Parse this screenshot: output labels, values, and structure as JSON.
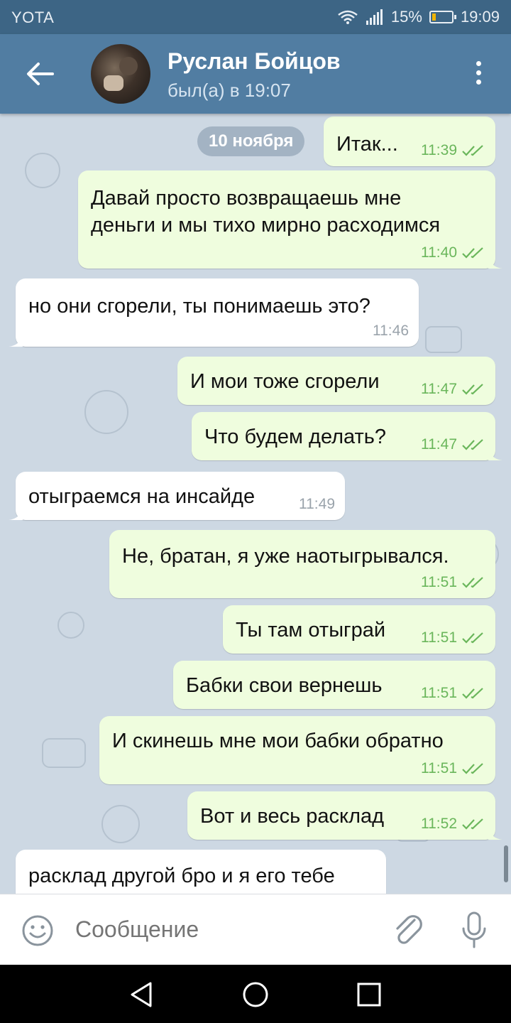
{
  "status_bar": {
    "carrier": "YOTA",
    "battery": "15%",
    "time": "19:09"
  },
  "header": {
    "name": "Руслан Бойцов",
    "status": "был(а) в 19:07"
  },
  "date_chip": "10 ноября",
  "messages": [
    {
      "dir": "out",
      "text": "Итак...",
      "time": "11:39"
    },
    {
      "dir": "out",
      "text": "Давай просто возвращаешь мне\nденьги и мы тихо мирно расходимся",
      "time": "11:40"
    },
    {
      "dir": "in",
      "text": "но они сгорели, ты понимаешь это?",
      "time": "11:46"
    },
    {
      "dir": "out",
      "text": "И мои тоже сгорели",
      "time": "11:47"
    },
    {
      "dir": "out",
      "text": "Что будем делать?",
      "time": "11:47"
    },
    {
      "dir": "in",
      "text": "отыграемся на инсайде",
      "time": "11:49"
    },
    {
      "dir": "out",
      "text": "Не, братан, я уже наотыгрывался.",
      "time": "11:51"
    },
    {
      "dir": "out",
      "text": "Ты там отыграй",
      "time": "11:51"
    },
    {
      "dir": "out",
      "text": "Бабки свои вернешь",
      "time": "11:51"
    },
    {
      "dir": "out",
      "text": "И скинешь мне мои бабки обратно",
      "time": "11:51"
    },
    {
      "dir": "out",
      "text": "Вот и весь расклад",
      "time": "11:52"
    },
    {
      "dir": "in",
      "text": "расклад другой бро и я его тебе",
      "time": ""
    }
  ],
  "input": {
    "placeholder": "Сообщение"
  },
  "colors": {
    "header": "#517da2",
    "outgoing_bubble": "#effdde",
    "incoming_bubble": "#ffffff",
    "check": "#6ab65b"
  },
  "icons": [
    "back-arrow-icon",
    "more-vert-icon",
    "emoji-icon",
    "attach-icon",
    "mic-icon",
    "double-check-icon",
    "wifi-icon",
    "signal-icon",
    "battery-icon"
  ]
}
